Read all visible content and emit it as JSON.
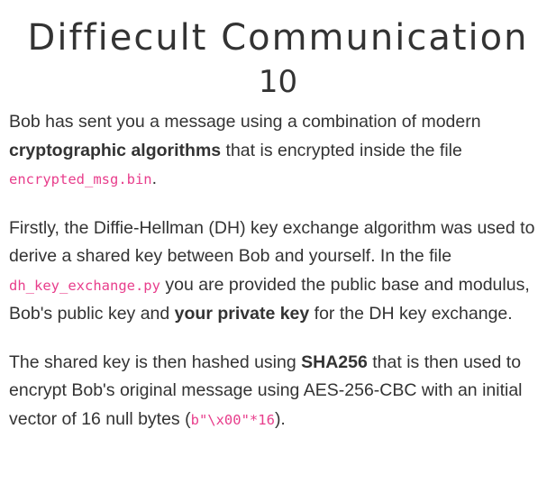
{
  "challenge": {
    "title": "Diffiecult Communication",
    "points": "10"
  },
  "description": {
    "p1": {
      "t1": "Bob has sent you a message using a combination of modern ",
      "b1": "cryptographic algorithms",
      "t2": " that is encrypted inside the file ",
      "c1": "encrypted_msg.bin",
      "t3": "."
    },
    "p2": {
      "t1": "Firstly, the Diffie-Hellman (DH) key exchange algorithm was used to derive a shared key between Bob and yourself. In the file ",
      "c1": "dh_key_exchange.py",
      "t2": " you are provided the public base and modulus, Bob's public key and ",
      "b1": "your private key",
      "t3": " for the DH key exchange."
    },
    "p3": {
      "t1": "The shared key is then hashed using ",
      "b1": "SHA256",
      "t2": " that is then used to encrypt Bob's original message using AES-256-CBC with an initial vector of 16 null bytes (",
      "c1": "b\"\\x00\"*16",
      "t3": ")."
    }
  },
  "colors": {
    "text": "#333333",
    "code": "#e83e8c",
    "background": "#ffffff"
  }
}
